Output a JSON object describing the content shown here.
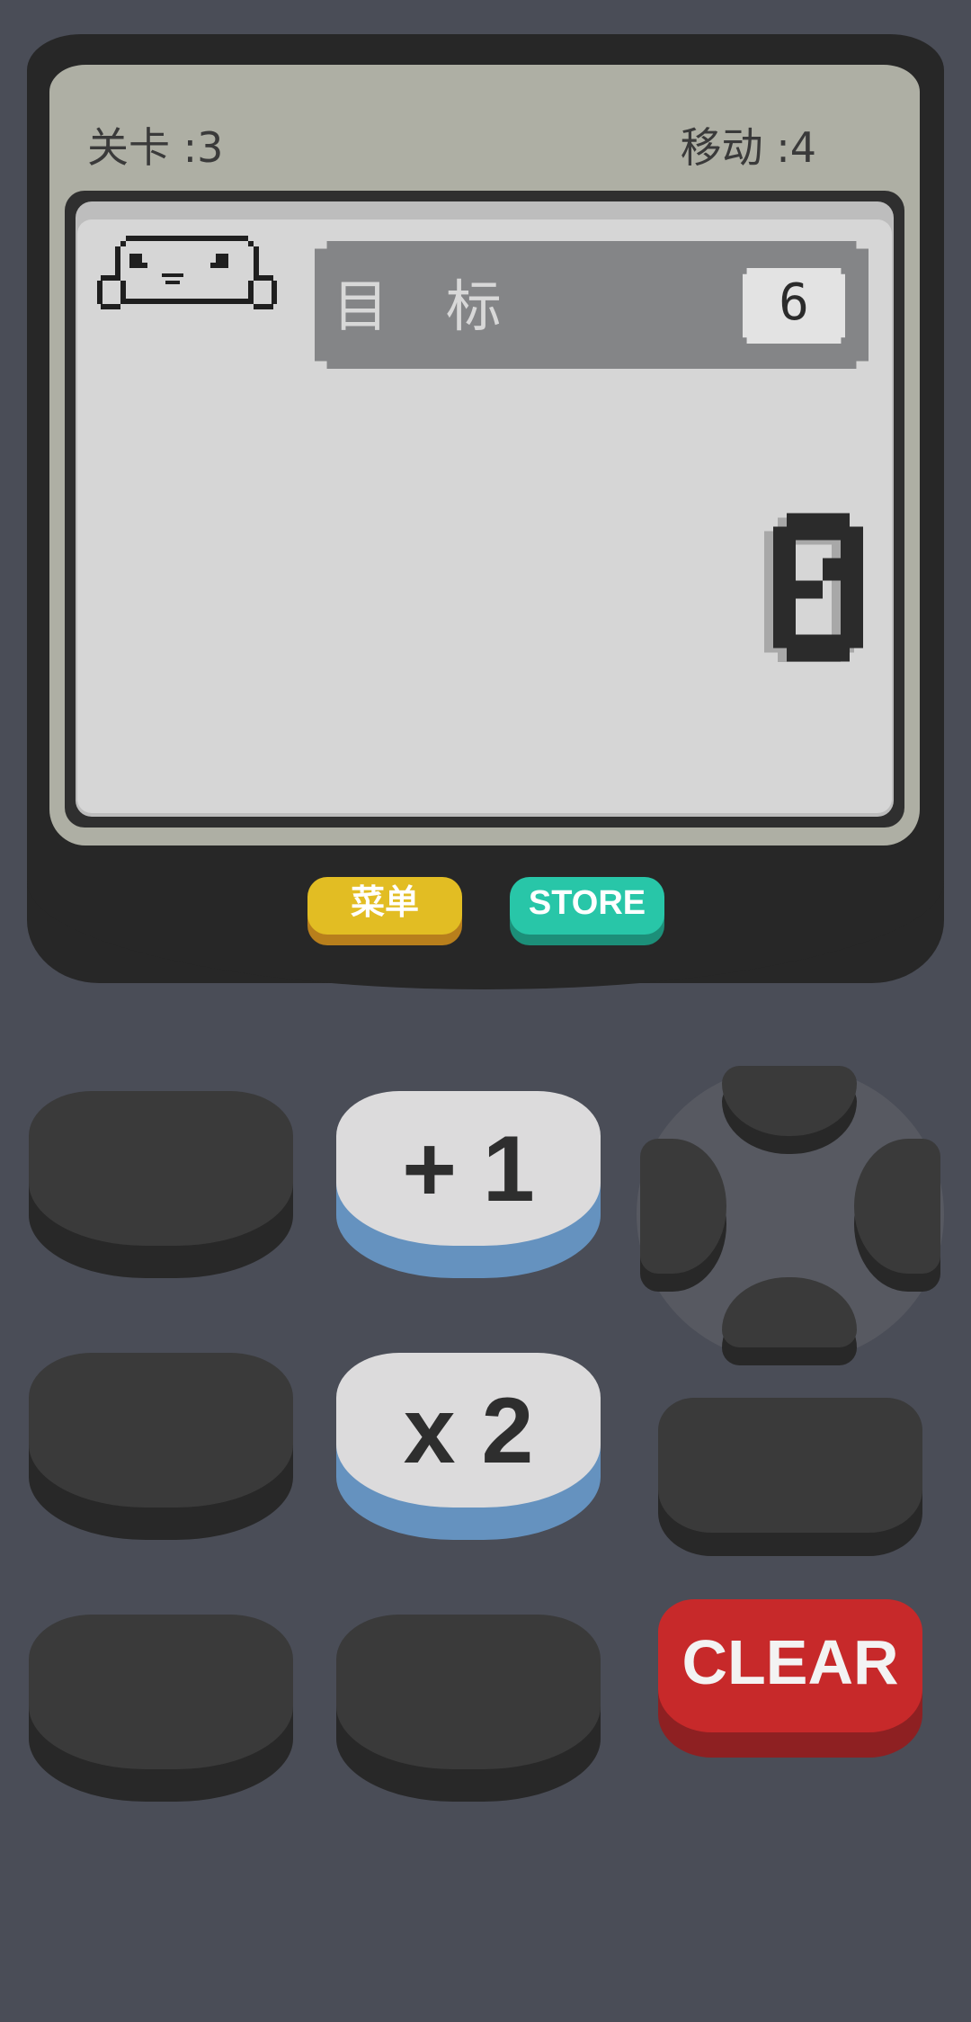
{
  "header": {
    "level_label": "关卡 :3",
    "moves_label": "移动 :4"
  },
  "goal": {
    "label": "目 标",
    "value": "6"
  },
  "display": {
    "current_value": "0"
  },
  "buttons": {
    "menu": "菜单",
    "store": "STORE",
    "plus_one": "+ 1",
    "times_two": "x 2",
    "clear": "CLEAR"
  },
  "colors": {
    "background": "#4a4d57",
    "menu": "#e2bd23",
    "store": "#28c6a8",
    "clear": "#c7292a",
    "operation_key_base": "#6592bf"
  }
}
